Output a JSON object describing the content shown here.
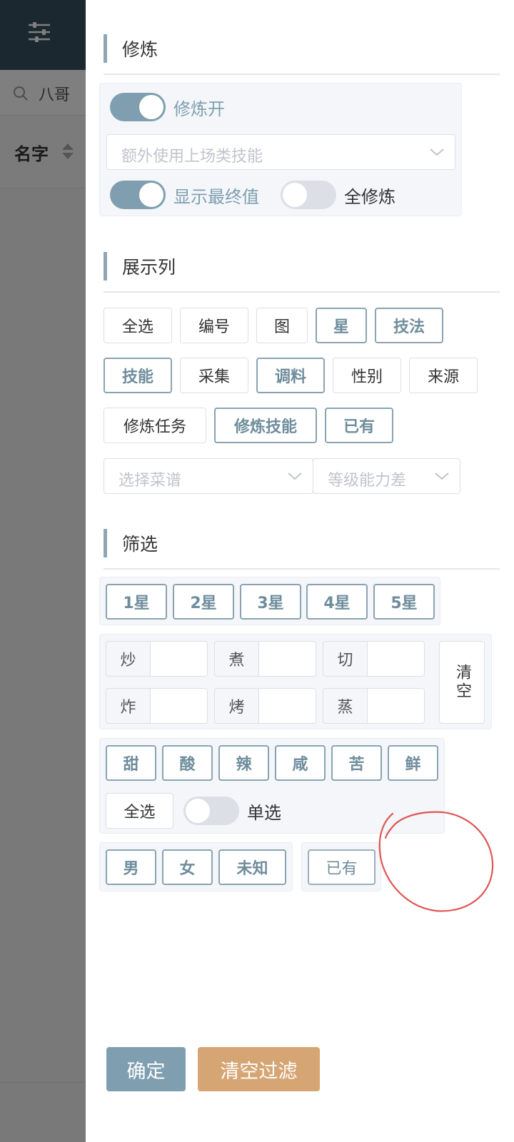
{
  "background": {
    "search_text": "八哥",
    "column_title": "名字"
  },
  "cultivation": {
    "title": "修炼",
    "toggle_main_label": "修炼开",
    "toggle_main_on": true,
    "extra_skill_placeholder": "额外使用上场类技能",
    "show_final_label": "显示最终值",
    "show_final_on": true,
    "all_cultivate_label": "全修炼",
    "all_cultivate_on": false
  },
  "columns": {
    "title": "展示列",
    "buttons": [
      {
        "label": "全选",
        "selected": false
      },
      {
        "label": "编号",
        "selected": false
      },
      {
        "label": "图",
        "selected": false
      },
      {
        "label": "星",
        "selected": true
      },
      {
        "label": "技法",
        "selected": true
      },
      {
        "label": "技能",
        "selected": true
      },
      {
        "label": "采集",
        "selected": false
      },
      {
        "label": "调料",
        "selected": true
      },
      {
        "label": "性别",
        "selected": false
      },
      {
        "label": "来源",
        "selected": false
      },
      {
        "label": "修炼任务",
        "selected": false
      },
      {
        "label": "修炼技能",
        "selected": true
      },
      {
        "label": "已有",
        "selected": true
      }
    ],
    "recipe_placeholder": "选择菜谱",
    "level_diff_placeholder": "等级能力差"
  },
  "filter": {
    "title": "筛选",
    "stars": [
      "1星",
      "2星",
      "3星",
      "4星",
      "5星"
    ],
    "cuts": [
      "炒",
      "煮",
      "切",
      "炸",
      "烤",
      "蒸"
    ],
    "clear_label": "清空",
    "flavors": [
      "甜",
      "酸",
      "辣",
      "咸",
      "苦",
      "鲜"
    ],
    "flavor_select_all": "全选",
    "single_select_label": "单选",
    "single_select_on": false,
    "genders": [
      "男",
      "女",
      "未知"
    ],
    "owned_label": "已有"
  },
  "actions": {
    "confirm_label": "确定",
    "clear_filter_label": "清空过滤"
  },
  "colors": {
    "accent": "#7f9fb0",
    "clear_button": "#d6a574",
    "header_dark": "#36505e",
    "annotation": "#e05555"
  }
}
